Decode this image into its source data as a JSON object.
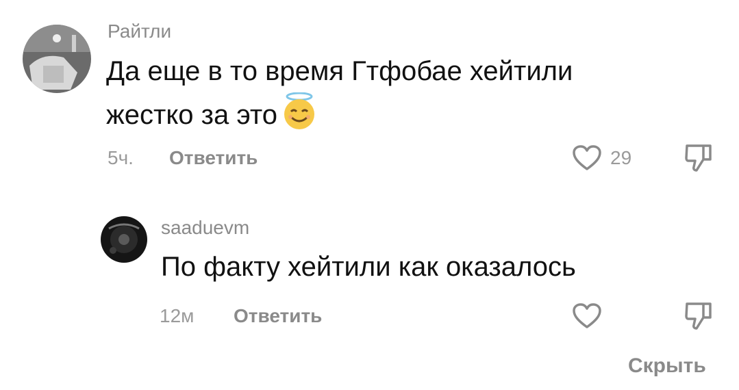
{
  "comments": [
    {
      "username": "Райтли",
      "text_line1": "Да еще в то время Гтфобае хейтили",
      "text_line2": "жестко за это",
      "emoji": "smiling-face-with-halo",
      "time": "5ч.",
      "reply_label": "Ответить",
      "likes": "29"
    },
    {
      "username": "saaduevm",
      "text": "По факту хейтили как оказалось",
      "time": "12м",
      "reply_label": "Ответить",
      "likes": ""
    }
  ],
  "hide_label": "Скрыть",
  "colors": {
    "text": "#111111",
    "meta": "#8a8a8a",
    "background": "#ffffff"
  }
}
